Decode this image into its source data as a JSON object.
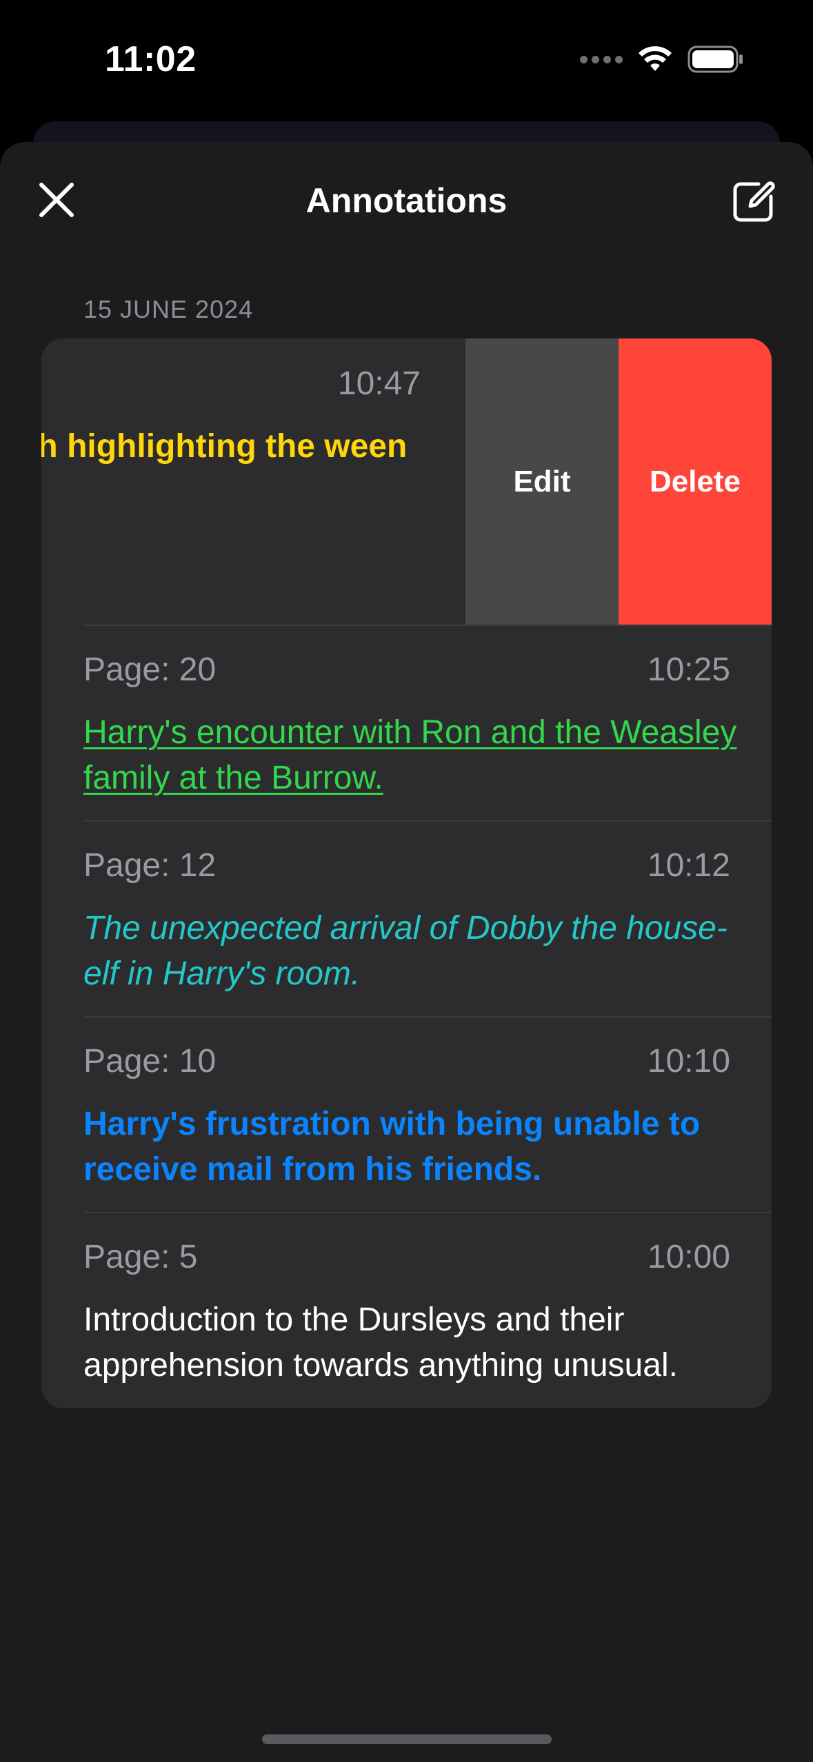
{
  "status_bar": {
    "time": "11:02"
  },
  "header": {
    "title": "Annotations",
    "close_icon": "close-icon",
    "compose_icon": "compose-icon"
  },
  "section": {
    "date": "15 JUNE 2024"
  },
  "swiped_row": {
    "time": "10:47",
    "text": "s fascination with highlighting the ween wizards and",
    "edit_label": "Edit",
    "delete_label": "Delete"
  },
  "annotations": [
    {
      "page": "Page: 20",
      "time": "10:25",
      "text": "Harry's encounter with Ron and the Weasley family at the Burrow.",
      "style": "underline",
      "color": "#32d74b"
    },
    {
      "page": "Page: 12",
      "time": "10:12",
      "text": "The unexpected arrival of Dobby the house-elf in Harry's room.",
      "style": "italic",
      "color": "#24c8c8"
    },
    {
      "page": "Page: 10",
      "time": "10:10",
      "text": "Harry's frustration with being unable to receive mail from his friends.",
      "style": "bold",
      "color": "#0a84ff"
    },
    {
      "page": "Page: 5",
      "time": "10:00",
      "text": "Introduction to the Dursleys and their apprehension towards anything unusual.",
      "style": "plain",
      "color": "#ffffff"
    }
  ],
  "colors": {
    "background": "#1c1c1e",
    "cell": "#2c2c2e",
    "delete": "#ff453a",
    "edit": "#48484a",
    "highlight_yellow": "#ffd60a"
  }
}
